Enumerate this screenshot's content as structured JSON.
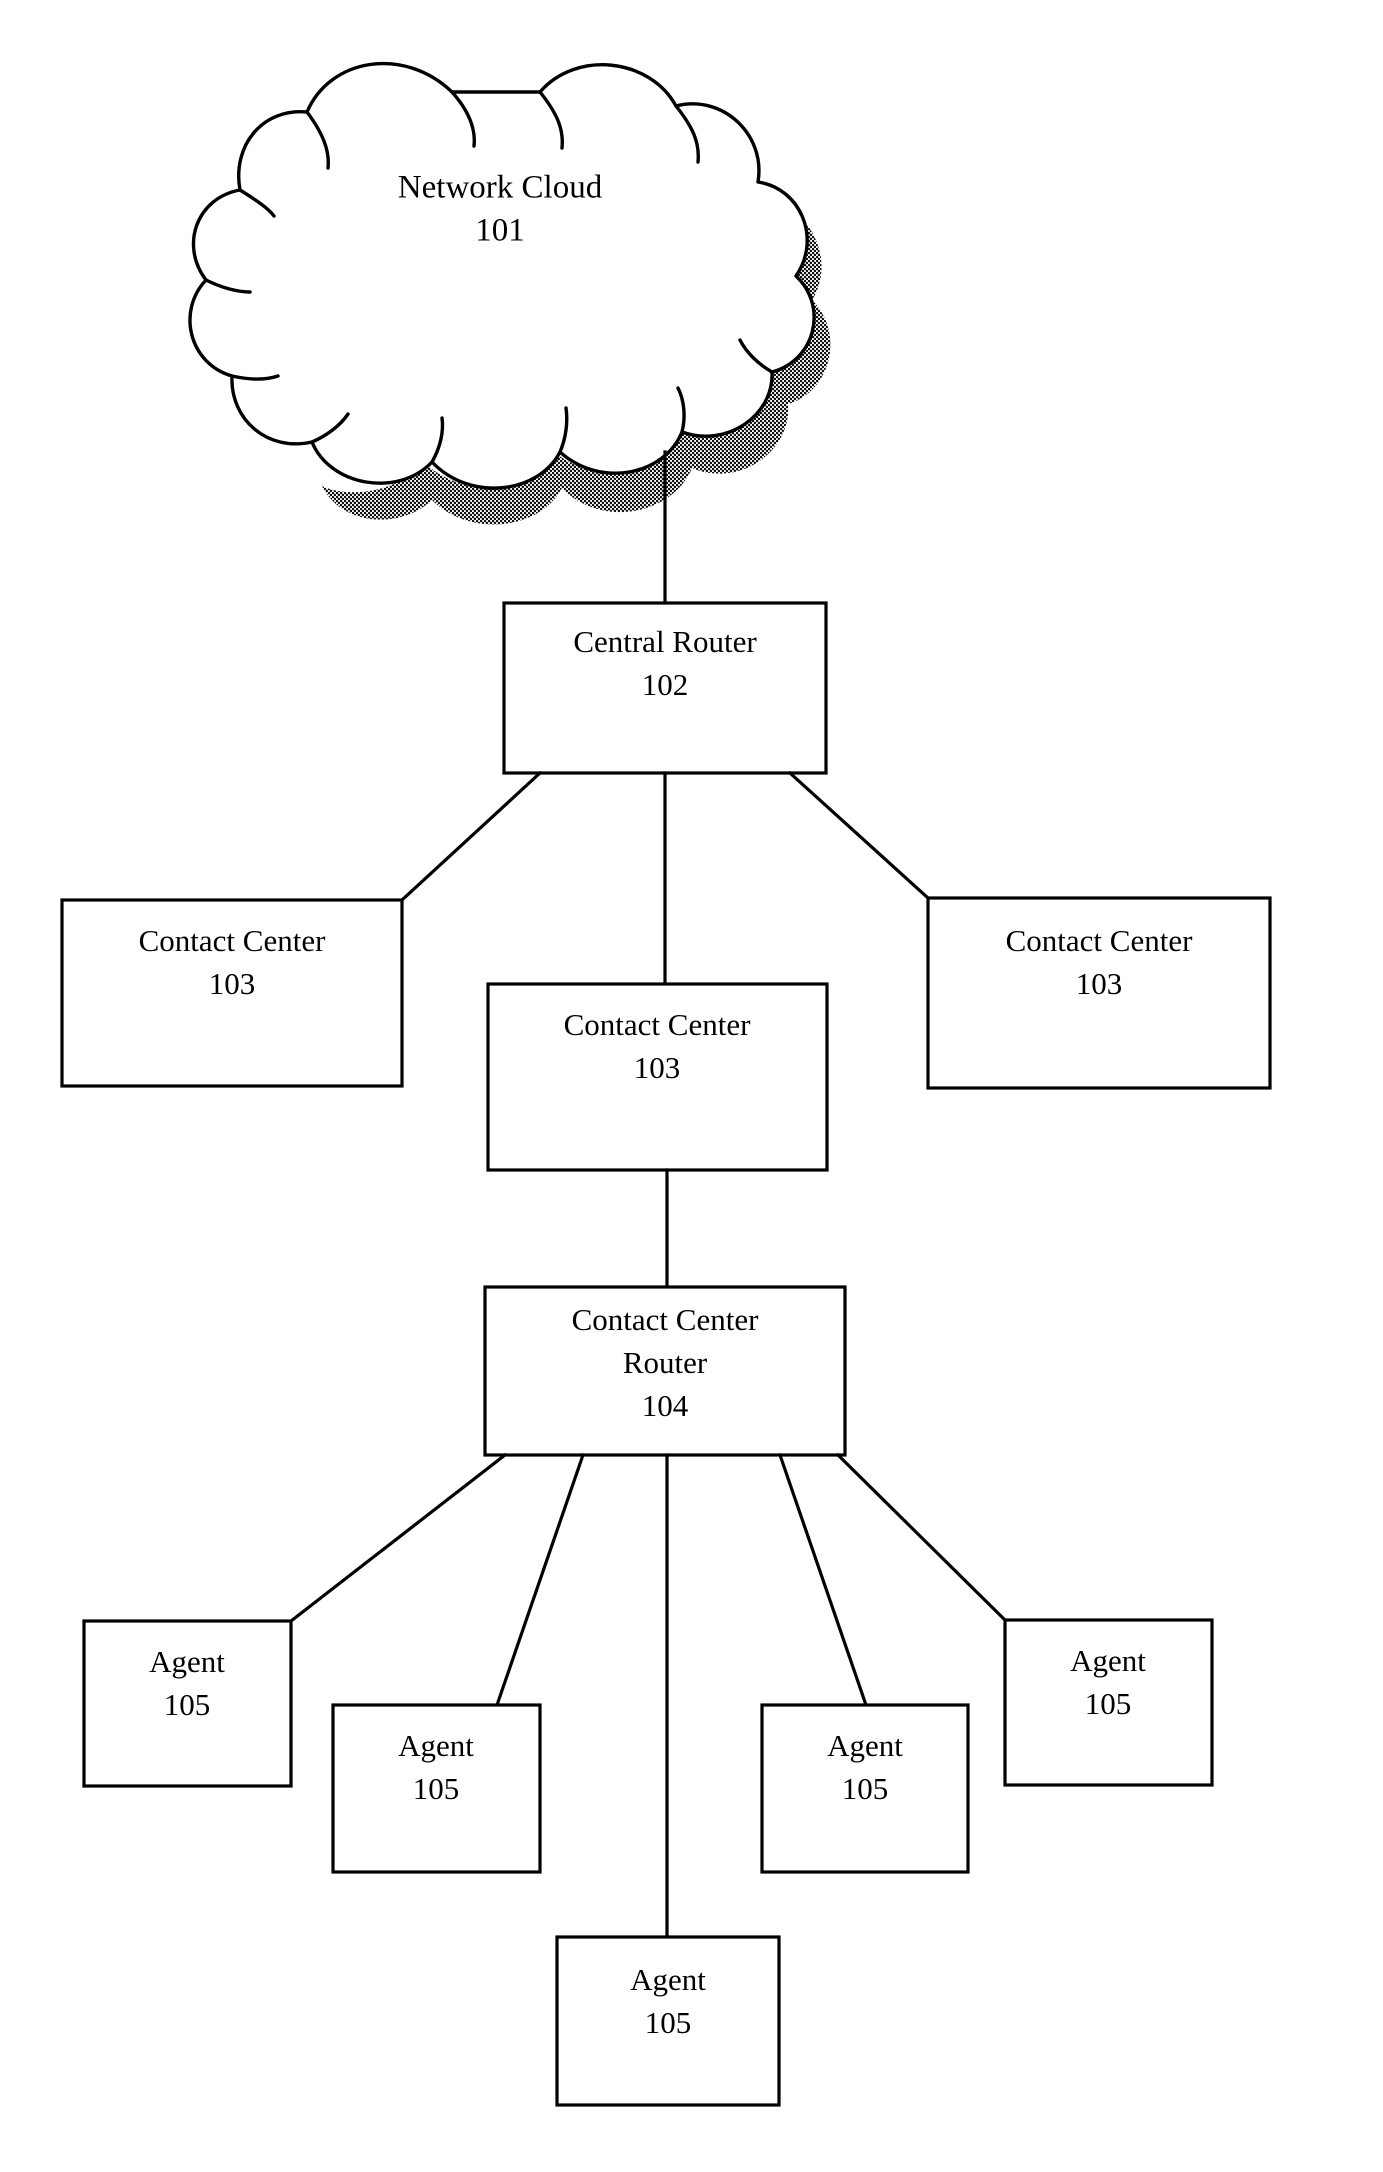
{
  "figure": {
    "type": "patent-network-diagram",
    "background_color": "#ffffff",
    "line_color": "#000000",
    "nodes": {
      "cloud": {
        "line1": "Network Cloud",
        "line2": "101",
        "ref_number": "101",
        "shape": "cloud"
      },
      "central_router": {
        "line1": "Central Router",
        "line2": "102",
        "ref_number": "102",
        "shape": "rectangle"
      },
      "contact_center_left": {
        "line1": "Contact Center",
        "line2": "103",
        "ref_number": "103",
        "shape": "rectangle"
      },
      "contact_center_middle": {
        "line1": "Contact Center",
        "line2": "103",
        "ref_number": "103",
        "shape": "rectangle"
      },
      "contact_center_right": {
        "line1": "Contact Center",
        "line2": "103",
        "ref_number": "103",
        "shape": "rectangle"
      },
      "contact_center_router": {
        "line1": "Contact Center",
        "line2": "Router",
        "line3": "104",
        "ref_number": "104",
        "shape": "rectangle"
      },
      "agent_1": {
        "line1": "Agent",
        "line2": "105",
        "ref_number": "105",
        "shape": "rectangle"
      },
      "agent_2": {
        "line1": "Agent",
        "line2": "105",
        "ref_number": "105",
        "shape": "rectangle"
      },
      "agent_3": {
        "line1": "Agent",
        "line2": "105",
        "ref_number": "105",
        "shape": "rectangle"
      },
      "agent_4": {
        "line1": "Agent",
        "line2": "105",
        "ref_number": "105",
        "shape": "rectangle"
      },
      "agent_5": {
        "line1": "Agent",
        "line2": "105",
        "ref_number": "105",
        "shape": "rectangle"
      }
    },
    "connections": [
      {
        "from": "cloud",
        "to": "central_router"
      },
      {
        "from": "central_router",
        "to": "contact_center_left"
      },
      {
        "from": "central_router",
        "to": "contact_center_middle"
      },
      {
        "from": "central_router",
        "to": "contact_center_right"
      },
      {
        "from": "contact_center_middle",
        "to": "contact_center_router"
      },
      {
        "from": "contact_center_router",
        "to": "agent_1"
      },
      {
        "from": "contact_center_router",
        "to": "agent_2"
      },
      {
        "from": "contact_center_router",
        "to": "agent_3"
      },
      {
        "from": "contact_center_router",
        "to": "agent_4"
      },
      {
        "from": "contact_center_router",
        "to": "agent_5"
      }
    ]
  }
}
